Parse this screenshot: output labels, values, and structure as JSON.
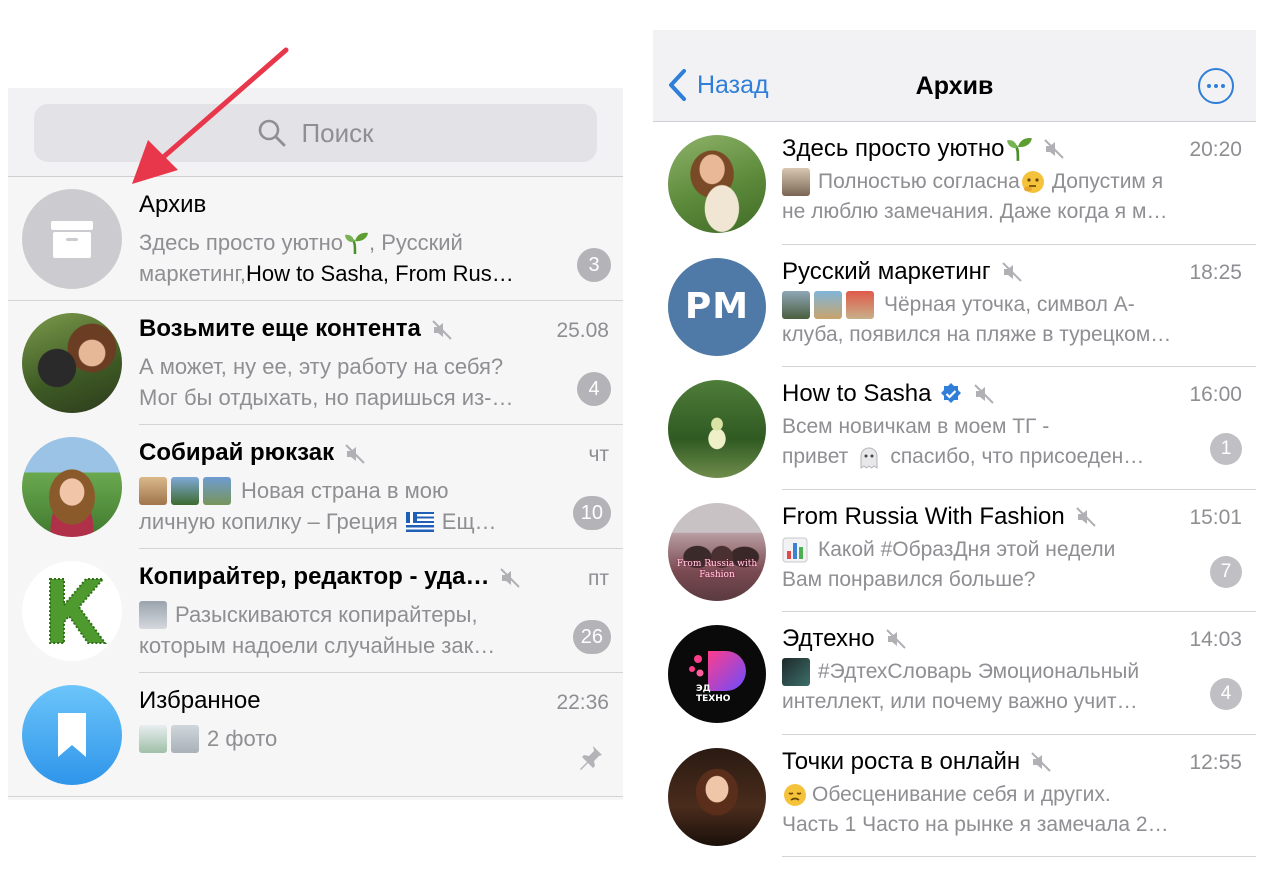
{
  "left": {
    "search": {
      "placeholder": "Поиск"
    },
    "chats": [
      {
        "title": "Архив",
        "time": "",
        "preview_l1": "Здесь просто уютно",
        "preview_l1_b": ", Русский",
        "preview_l2_a": "маркетинг, ",
        "preview_l2_b": "How to Sasha, From Rus…",
        "badge": "3"
      },
      {
        "title": "Возьмите еще контента",
        "time": "25.08",
        "preview_l1": "А может, ну ее, эту работу на себя?",
        "preview_l2": "Мог бы отдыхать, но паришься из-…",
        "badge": "4"
      },
      {
        "title": "Собирай рюкзак",
        "time": "чт",
        "preview_l1": "Новая страна в мою",
        "preview_l2": "личную копилку – Греция",
        "preview_l2_b": "Ещ…",
        "badge": "10"
      },
      {
        "title": "Копирайтер, редактор - уда…",
        "time": "пт",
        "preview_l1": "Разыскиваются копирайтеры,",
        "preview_l2": "которым надоели случайные зак…",
        "badge": "26"
      },
      {
        "title": "Избранное",
        "time": "22:36",
        "preview_l1": "2 фото",
        "badge": ""
      }
    ]
  },
  "right": {
    "nav": {
      "back_label": "Назад",
      "title": "Архив"
    },
    "chats": [
      {
        "title": "Здесь просто уютно",
        "time": "20:20",
        "preview_l1": "Полностью согласна",
        "preview_l1_b": "Допустим я",
        "preview_l2": "не люблю замечания. Даже когда я м…",
        "badge": ""
      },
      {
        "title": "Русский маркетинг",
        "time": "18:25",
        "avatar_text": "PM",
        "preview_l1": "Чёрная уточка, символ А-",
        "preview_l2": "клуба, появился на пляже в турецком…",
        "badge": ""
      },
      {
        "title": "How to Sasha",
        "time": "16:00",
        "preview_l1": "Всем новичкам в моем ТГ -",
        "preview_l2_a": "привет",
        "preview_l2_b": "спасибо, что присоеден…",
        "badge": "1"
      },
      {
        "title": "From Russia With Fashion",
        "time": "15:01",
        "avatar_text_1": "From Russia with",
        "avatar_text_2": "Fashion",
        "preview_l1": "Какой #ОбразДня этой недели",
        "preview_l2": "Вам понравился больше?",
        "badge": "7"
      },
      {
        "title": "Эдтехно",
        "time": "14:03",
        "avatar_text_1": "ЭД",
        "avatar_text_2": "ТЕХНО",
        "preview_l1": "#ЭдтехСловарь Эмоциональный",
        "preview_l2": "интеллект, или почему важно учит…",
        "badge": "4"
      },
      {
        "title": "Точки роста в онлайн",
        "time": "12:55",
        "preview_l1": "Обесценивание себя и других.",
        "preview_l2": "Часть 1 Часто на рынке я замечала 2…",
        "badge": ""
      }
    ]
  },
  "colors": {
    "accent": "#2f7ed8",
    "arrow": "#e8374a",
    "badge": "#b3b3b8",
    "secondary_text": "#8e8e93"
  }
}
